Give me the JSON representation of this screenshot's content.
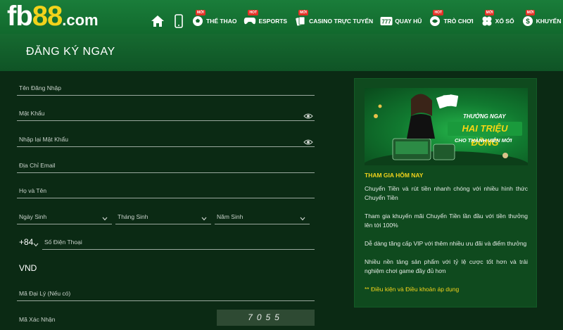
{
  "header": {
    "logo": {
      "fb": "fb",
      "n88": "88",
      "dom": ".com"
    },
    "nav": [
      {
        "label": "THỂ THAO",
        "badge": "MỚI",
        "icon": "soccer-ball-icon"
      },
      {
        "label": "ESPORTS",
        "badge": "HOT",
        "icon": "gamepad-icon"
      },
      {
        "label": "CASINO TRỰC TUYẾN",
        "badge": "MỚI",
        "icon": "cards-icon"
      },
      {
        "label": "QUAY HŨ",
        "badge": "",
        "icon": "slot-777-icon"
      },
      {
        "label": "TRÒ CHƠI",
        "badge": "HOT",
        "icon": "game-icon"
      },
      {
        "label": "XỔ SỐ",
        "badge": "MỚI",
        "icon": "lottery-balls-icon"
      },
      {
        "label": "KHUYẾN MÃI",
        "badge": "MỚI",
        "icon": "promo-icon"
      }
    ]
  },
  "page": {
    "title": "ĐĂNG KÝ NGAY"
  },
  "form": {
    "username": "Tên Đăng Nhập",
    "password": "Mật Khẩu",
    "confirm_password": "Nhập lại Mật Khẩu",
    "email": "Địa Chỉ Email",
    "fullname": "Họ và Tên",
    "birth_day": "Ngày Sinh",
    "birth_month": "Tháng Sinh",
    "birth_year": "Năm Sinh",
    "country_code": "+84",
    "phone": "Số Điện Thoại",
    "currency": "VND",
    "agent_code": "Mã Đại Lý (Nếu có)",
    "captcha_label": "Mã Xác Nhận",
    "captcha_code": "7055"
  },
  "promo": {
    "banner_line1": "THƯỞNG NGAY",
    "banner_line2": "HAI TRIỆU ĐỒNG",
    "banner_line3": "CHO THÀNH VIÊN MỚI",
    "heading": "THAM GIA HÔM NAY",
    "paragraphs": [
      "Chuyển Tiền và rút tiền nhanh chóng với nhiều hình thức Chuyển Tiền",
      "Tham gia khuyến mãi Chuyển Tiền lần đầu với tiền thưởng lên tới 100%",
      "Dễ dàng tăng cấp VIP với thêm nhiều ưu đãi và điểm thưởng",
      "Nhiều nền tảng sản phẩm với tỷ lệ cược tốt hơn và trải nghiệm chơi game đầy đủ hơn"
    ],
    "terms": "** Điều kiện và Điều khoản áp dụng"
  },
  "colors": {
    "brand_green": "#11692d",
    "accent_yellow": "#f2d31b",
    "badge_red": "#e53228"
  }
}
